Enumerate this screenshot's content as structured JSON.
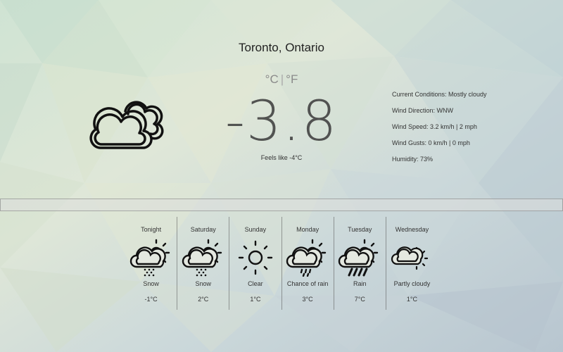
{
  "location": "Toronto, Ontario",
  "units": {
    "celsius": "°C",
    "separator": "|",
    "fahrenheit": "°F",
    "selected": "celsius"
  },
  "current": {
    "temperature": "-3.8",
    "feels_like": "Feels like -4°C",
    "icon": "cloud-icon",
    "conditions": [
      "Current Conditions: Mostly cloudy",
      "Wind Direction: WNW",
      "Wind Speed: 3.2 km/h | 2 mph",
      "Wind Gusts: 0 km/h | 0 mph",
      "Humidity: 73%"
    ]
  },
  "forecast": [
    {
      "day": "Tonight",
      "icon": "snow-icon",
      "condition": "Snow",
      "temp": "-1°C"
    },
    {
      "day": "Saturday",
      "icon": "snow-icon",
      "condition": "Snow",
      "temp": "2°C"
    },
    {
      "day": "Sunday",
      "icon": "sun-icon",
      "condition": "Clear",
      "temp": "1°C"
    },
    {
      "day": "Monday",
      "icon": "chance-of-rain-icon",
      "condition": "Chance of rain",
      "temp": "3°C"
    },
    {
      "day": "Tuesday",
      "icon": "rain-icon",
      "condition": "Rain",
      "temp": "7°C"
    },
    {
      "day": "Wednesday",
      "icon": "partly-cloudy-icon",
      "condition": "Partly cloudy",
      "temp": "1°C"
    }
  ]
}
